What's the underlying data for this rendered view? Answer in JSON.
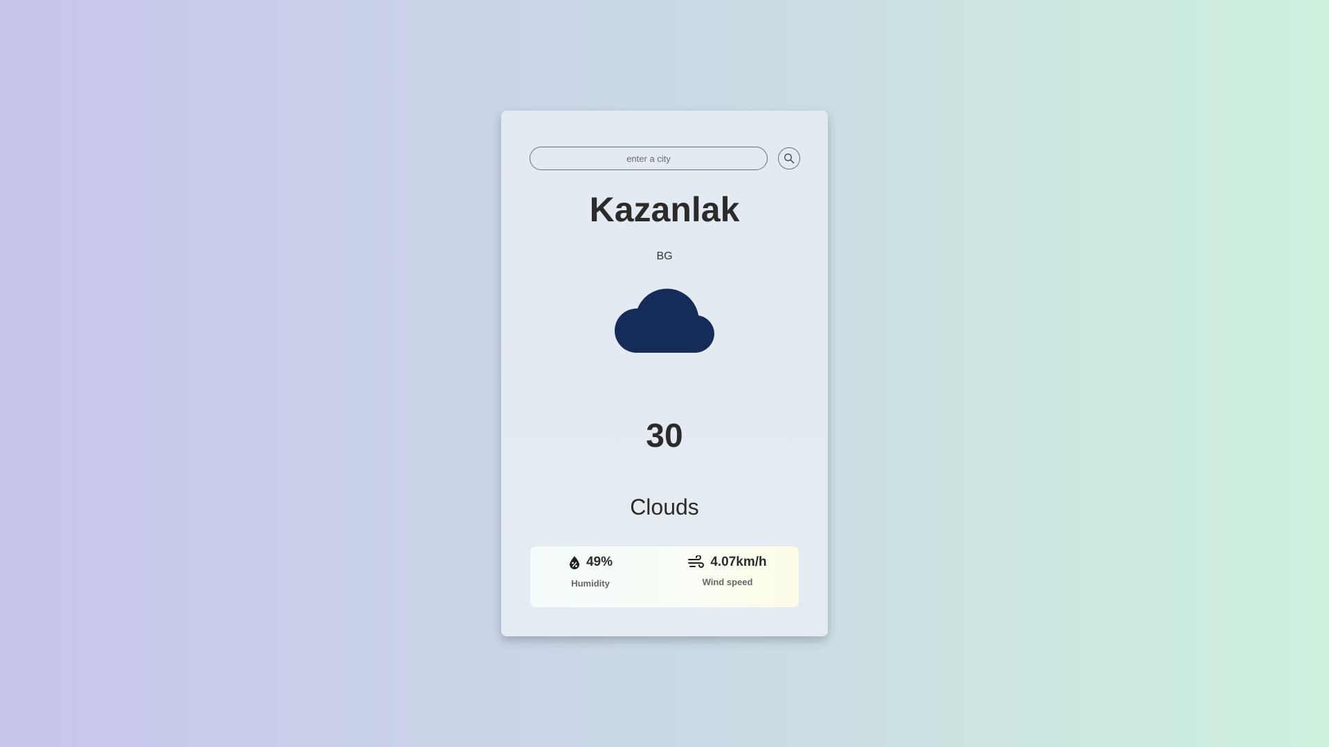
{
  "search": {
    "placeholder": "enter a city",
    "value": ""
  },
  "location": {
    "city": "Kazanlak",
    "country": "BG"
  },
  "weather": {
    "icon": "cloud-icon",
    "temperature": "30",
    "condition": "Clouds"
  },
  "details": {
    "humidity": {
      "value": "49%",
      "label": "Humidity",
      "icon": "humidity-drop-icon"
    },
    "wind": {
      "value": "4.07km/h",
      "label": "Wind speed",
      "icon": "wind-icon"
    }
  },
  "colors": {
    "cloud": "#152b58",
    "text": "#2b2b2b",
    "label": "#666666"
  }
}
